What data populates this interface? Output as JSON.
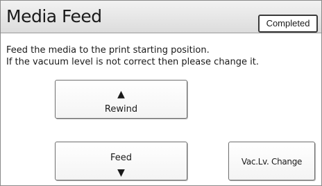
{
  "header": {
    "title": "Media Feed",
    "status_label": "Completed"
  },
  "message": {
    "line1": "Feed the media to the print starting position.",
    "line2": "If the vacuum level is not correct then please change it."
  },
  "buttons": {
    "rewind": {
      "label": "Rewind",
      "icon": "triangle-up-icon",
      "glyph": "▲"
    },
    "feed": {
      "label": "Feed",
      "icon": "triangle-down-icon",
      "glyph": "▼"
    },
    "vacuum_change": {
      "label": "Vac.Lv. Change"
    }
  },
  "colors": {
    "header_top": "#f2f2f2",
    "header_bottom": "#dcdcdc",
    "text": "#1a1a1a",
    "border": "#6e6e6e"
  }
}
